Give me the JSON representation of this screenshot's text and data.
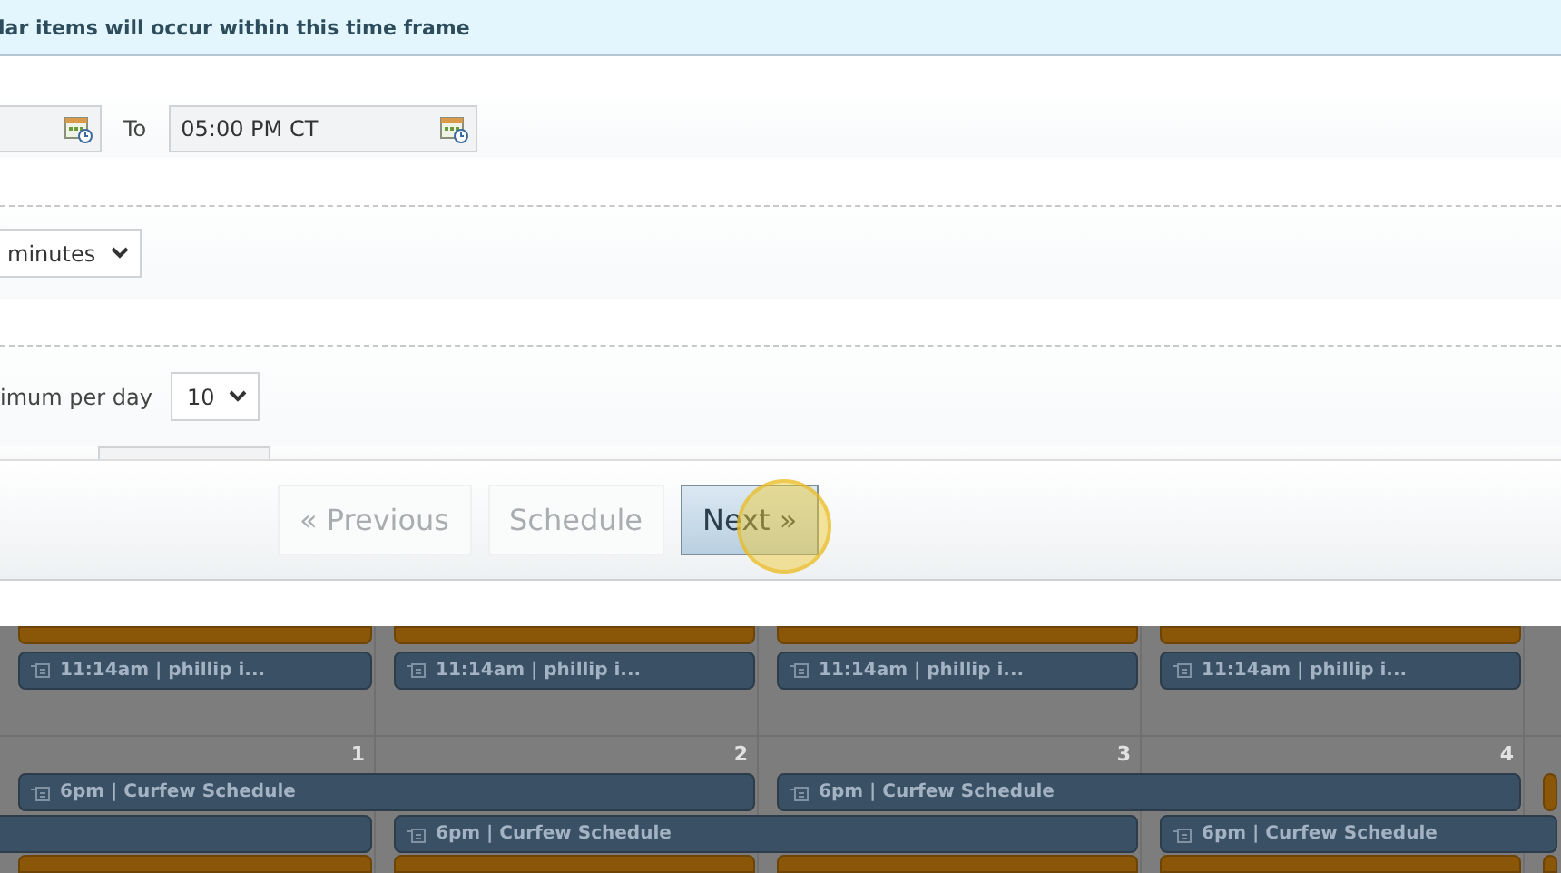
{
  "banner": {
    "text": "lar items will occur within this time frame"
  },
  "time_range": {
    "to_label": "To",
    "to_value": "05:00 PM CT"
  },
  "interval": {
    "value": "minutes"
  },
  "limit": {
    "label": "imum per day",
    "value": "10"
  },
  "buttons": [
    {
      "label": "« Previous",
      "disabled": true,
      "selected": false
    },
    {
      "label": "Schedule",
      "disabled": true,
      "selected": false
    },
    {
      "label": "Next »",
      "disabled": false,
      "selected": true
    }
  ],
  "calendar": {
    "day_numbers": [
      "1",
      "2",
      "3",
      "4"
    ],
    "events": [
      {
        "kind": "hidden"
      },
      {
        "kind": "scheduled",
        "text": "11:14am | phillip i..."
      },
      {
        "kind": "scheduled",
        "text": "11:14am | phillip i..."
      },
      {
        "kind": "scheduled",
        "text": "11:14am | phillip i..."
      },
      {
        "kind": "scheduled",
        "text": "11:14am | phillip i..."
      },
      {
        "kind": "scheduled",
        "text": "6pm | Curfew Schedule"
      },
      {
        "kind": "scheduled",
        "text": "6pm | Curfew Schedule"
      },
      {
        "kind": "scheduled",
        "text": "6pm | Curfew Schedule"
      },
      {
        "kind": "scheduled",
        "text": "6pm | Curfew Schedule"
      }
    ]
  }
}
